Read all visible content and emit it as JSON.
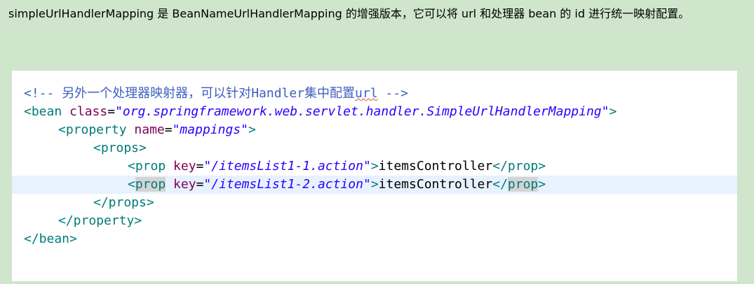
{
  "intro": {
    "text": "simpleUrlHandlerMapping 是 BeanNameUrlHandlerMapping 的增强版本，它可以将 url 和处理器 bean 的 id 进行统一映射配置。"
  },
  "code": {
    "comment_open": "<!-- ",
    "comment_cjk": "另外一个处理器映射器，可以针对",
    "comment_handler": "Handler",
    "comment_cjk2": "集中配置",
    "comment_url": "url",
    "comment_close": " -->",
    "bean_open": "<bean",
    "class_attr": "class",
    "eq": "=",
    "class_val": "\"org.springframework.web.servlet.handler.SimpleUrlHandlerMapping\"",
    "gt": ">",
    "property_open": "<property",
    "name_attr": "name",
    "name_val": "\"mappings\"",
    "props_open": "<props>",
    "prop_lt": "<",
    "prop_tag": "prop",
    "key_attr": "key",
    "key_val_1": "\"/itemsList1-1.action\"",
    "key_val_2": "\"/itemsList1-2.action\"",
    "content": "itemsController",
    "prop_close_lt": "</",
    "props_close": "</props>",
    "property_close": "</property>",
    "bean_close": "</bean>"
  }
}
